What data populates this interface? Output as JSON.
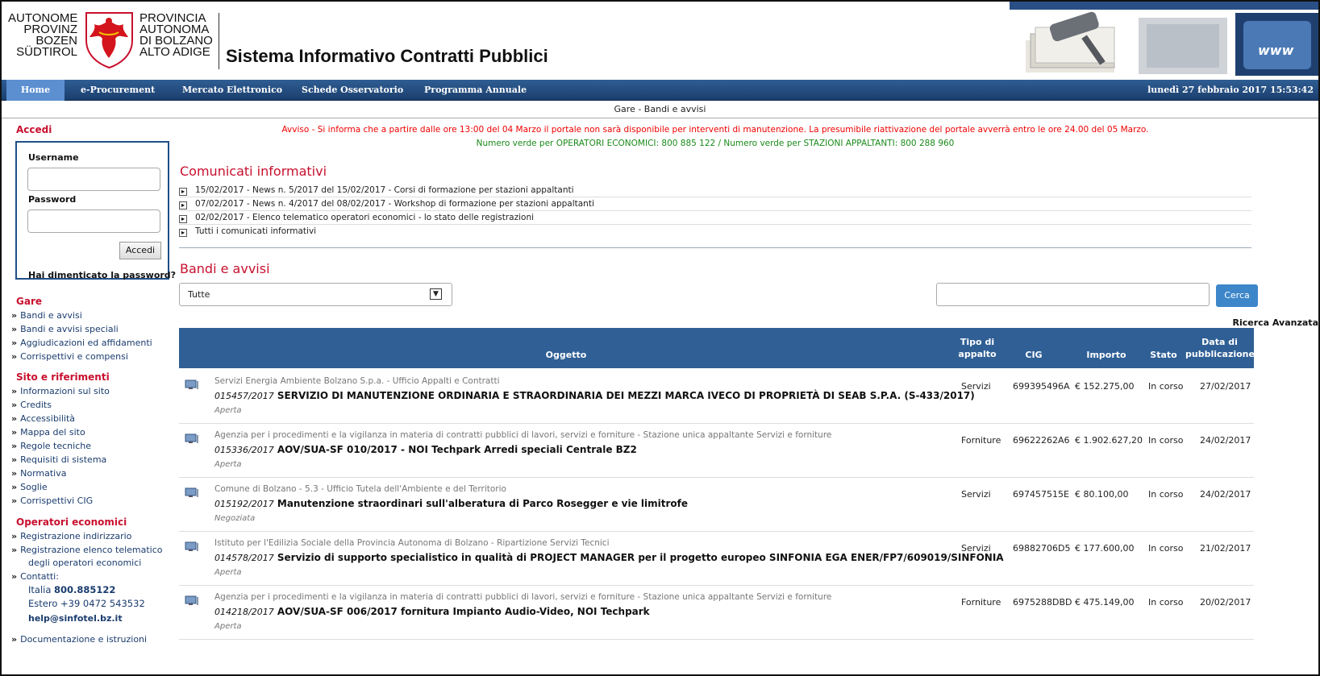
{
  "header": {
    "logo_left_lines": [
      "AUTONOME",
      "PROVINZ",
      "BOZEN",
      "SÜDTIROL"
    ],
    "logo_right_lines": [
      "PROVINCIA",
      "AUTONOMA",
      "DI BOLZANO",
      "ALTO ADIGE"
    ],
    "title": "Sistema Informativo Contratti Pubblici"
  },
  "nav": {
    "items": [
      "Home",
      "e-Procurement",
      "Mercato Elettronico",
      "Schede Osservatorio",
      "Programma Annuale"
    ],
    "datetime": "lunedì 27 febbraio 2017 15:53:42"
  },
  "breadcrumb": "Gare - Bandi e avvisi",
  "sidebar": {
    "login_title": "Accedi",
    "username_label": "Username",
    "password_label": "Password",
    "login_button": "Accedi",
    "forgot": "Hai dimenticato la password?",
    "gare_title": "Gare",
    "gare_links": [
      "Bandi e avvisi",
      "Bandi e avvisi speciali",
      "Aggiudicazioni ed affidamenti",
      "Corrispettivi e compensi"
    ],
    "sito_title": "Sito e riferimenti",
    "sito_links": [
      "Informazioni sul sito",
      "Credits",
      "Accessibilità",
      "Mappa del sito",
      "Regole tecniche",
      "Requisiti di sistema",
      "Normativa",
      "Soglie",
      "Corrispettivi CIG"
    ],
    "op_title": "Operatori economici",
    "op_link1": "Registrazione indirizzario",
    "op_link2_line1": "Registrazione elenco telematico",
    "op_link2_line2": "degli operatori economici",
    "contatti": "Contatti:",
    "italia_label": "Italia",
    "italia_num": "800.885122",
    "estero": "Estero +39 0472 543532",
    "email": "help@sinfotel.bz.it",
    "doc_link": "Documentazione e istruzioni"
  },
  "main": {
    "notice_red": "Avviso - Si informa che a partire dalle ore 13:00 del 04 Marzo il portale non sarà disponibile per interventi di manutenzione. La presumibile riattivazione del portale avverrà entro le ore 24.00 del 05 Marzo.",
    "notice_green": "Numero verde per OPERATORI ECONOMICI: 800 885 122 / Numero verde per STAZIONI APPALTANTI: 800 288 960",
    "news_title": "Comunicati informativi",
    "news": [
      "15/02/2017 - News n. 5/2017 del 15/02/2017 - Corsi di formazione per stazioni appaltanti",
      "07/02/2017 - News n. 4/2017 del 08/02/2017 - Workshop di formazione per stazioni appaltanti",
      "02/02/2017 - Elenco telematico operatori economici - lo stato delle registrazioni",
      "Tutti i comunicati informativi"
    ],
    "bandi_title": "Bandi e avvisi",
    "filter_value": "Tutte",
    "search_button": "Cerca",
    "advanced": "Ricerca Avanzata",
    "columns": {
      "oggetto": "Oggetto",
      "tipo_l1": "Tipo di",
      "tipo_l2": "appalto",
      "cig": "CIG",
      "importo": "Importo",
      "stato": "Stato",
      "data_l1": "Data di",
      "data_l2": "pubblicazione"
    },
    "rows": [
      {
        "ente": "Servizi Energia Ambiente Bolzano S.p.a. - Ufficio Appalti e Contratti",
        "num": "015457/2017",
        "oggetto": "SERVIZIO DI MANUTENZIONE ORDINARIA E STRAORDINARIA DEI MEZZI MARCA IVECO DI PROPRIETÀ DI SEAB S.P.A. (S-433/2017)",
        "proc": "Aperta",
        "tipo": "Servizi",
        "cig": "699395496A",
        "importo": "€ 152.275,00",
        "stato": "In corso",
        "data": "27/02/2017"
      },
      {
        "ente": "Agenzia per i procedimenti e la vigilanza in materia di contratti pubblici di lavori, servizi e forniture - Stazione unica appaltante Servizi e forniture",
        "num": "015336/2017",
        "oggetto": "AOV/SUA-SF 010/2017 - NOI Techpark Arredi speciali Centrale BZ2",
        "proc": "Aperta",
        "tipo": "Forniture",
        "cig": "69622262A6",
        "importo": "€ 1.902.627,20",
        "stato": "In corso",
        "data": "24/02/2017"
      },
      {
        "ente": "Comune di Bolzano - 5.3 - Ufficio Tutela dell'Ambiente e del Territorio",
        "num": "015192/2017",
        "oggetto": "Manutenzione straordinari sull'alberatura di Parco Rosegger e vie limitrofe",
        "proc": "Negoziata",
        "tipo": "Servizi",
        "cig": "697457515E",
        "importo": "€ 80.100,00",
        "stato": "In corso",
        "data": "24/02/2017"
      },
      {
        "ente": "Istituto per l'Edilizia Sociale della Provincia Autonoma di Bolzano - Ripartizione Servizi Tecnici",
        "num": "014578/2017",
        "oggetto": "Servizio di supporto specialistico in qualità di PROJECT MANAGER per il progetto europeo SINFONIA EGA ENER/FP7/609019/SINFONIA",
        "proc": "Aperta",
        "tipo": "Servizi",
        "cig": "69882706D5",
        "importo": "€ 177.600,00",
        "stato": "In corso",
        "data": "21/02/2017"
      },
      {
        "ente": "Agenzia per i procedimenti e la vigilanza in materia di contratti pubblici di lavori, servizi e forniture - Stazione unica appaltante Servizi e forniture",
        "num": "014218/2017",
        "oggetto": "AOV/SUA-SF 006/2017 fornitura Impianto Audio-Video, NOI Techpark",
        "proc": "Aperta",
        "tipo": "Forniture",
        "cig": "6975288DBD",
        "importo": "€ 475.149,00",
        "stato": "In corso",
        "data": "20/02/2017"
      }
    ]
  }
}
